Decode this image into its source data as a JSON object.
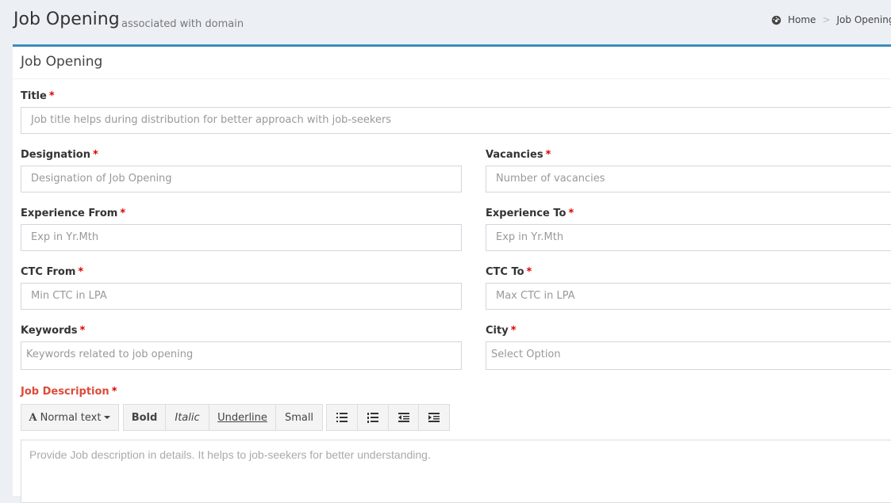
{
  "header": {
    "title": "Job Opening",
    "subtitle": "associated with domain",
    "breadcrumb": [
      "Home",
      "Job Opening"
    ]
  },
  "box": {
    "title": "Job Opening"
  },
  "form": {
    "title": {
      "label": "Title",
      "required": "*",
      "placeholder": "Job title helps during distribution for better approach with job-seekers"
    },
    "designation": {
      "label": "Designation",
      "required": "*",
      "placeholder": "Designation of Job Opening"
    },
    "vacancies": {
      "label": "Vacancies",
      "required": "*",
      "placeholder": "Number of vacancies"
    },
    "experience_from": {
      "label": "Experience From",
      "required": "*",
      "placeholder": "Exp in Yr.Mth"
    },
    "experience_to": {
      "label": "Experience To",
      "required": "*",
      "placeholder": "Exp in Yr.Mth"
    },
    "ctc_from": {
      "label": "CTC From",
      "required": "*",
      "placeholder": "Min CTC in LPA"
    },
    "ctc_to": {
      "label": "CTC To",
      "required": "*",
      "placeholder": "Max CTC in LPA"
    },
    "keywords": {
      "label": "Keywords",
      "required": "*",
      "placeholder": "Keywords related to job opening"
    },
    "city": {
      "label": "City",
      "required": "*",
      "selected": "Select Option"
    },
    "job_description": {
      "label": "Job Description",
      "required": "*",
      "placeholder": "Provide Job description in details. It helps to job-seekers for better understanding."
    }
  },
  "editor_toolbar": {
    "font_style": "Normal text",
    "font_style_icon": "A",
    "bold": "Bold",
    "italic": "Italic",
    "underline": "Underline",
    "small": "Small",
    "list_icons": [
      "unordered-list-icon",
      "ordered-list-icon",
      "outdent-icon",
      "indent-icon"
    ]
  },
  "colors": {
    "accent": "#3c8dbc",
    "required": "#dd0000",
    "error_label": "#dd4b39",
    "background": "#ecf0f5"
  }
}
